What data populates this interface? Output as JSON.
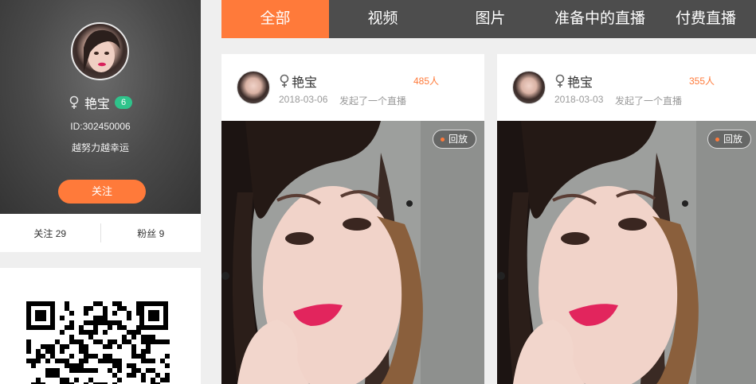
{
  "profile": {
    "name": "艳宝",
    "level": "6",
    "id_text": "ID:302450006",
    "signature": "越努力越幸运",
    "follow_label": "关注",
    "gender_icon": "female-icon"
  },
  "stats": {
    "following": "关注 29",
    "fans": "粉丝 9"
  },
  "tabs": [
    {
      "label": "全部",
      "active": true
    },
    {
      "label": "视频",
      "active": false
    },
    {
      "label": "图片",
      "active": false
    },
    {
      "label": "准备中的直播",
      "active": false
    },
    {
      "label": "付费直播",
      "active": false
    }
  ],
  "cards": [
    {
      "name": "艳宝",
      "viewers": "485人",
      "date": "2018-03-06",
      "action": "发起了一个直播",
      "badge": "回放"
    },
    {
      "name": "艳宝",
      "viewers": "355人",
      "date": "2018-03-03",
      "action": "发起了一个直播",
      "badge": "回放"
    }
  ],
  "colors": {
    "accent": "#ff7a3a",
    "tab_bar": "#4d4d4d",
    "level_badge": "#2fc38b"
  }
}
